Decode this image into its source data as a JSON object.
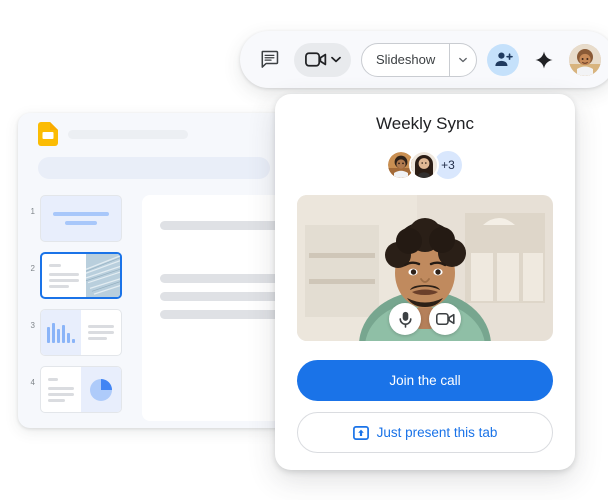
{
  "colors": {
    "brand_blue": "#1a73e8",
    "light_blue": "#c5e1fb",
    "badge_blue": "#d9e7fd",
    "slides_yellow": "#fbbc04",
    "window_bg": "#f6f8fc",
    "placeholder_gray": "#dadce0"
  },
  "toolbar": {
    "chat_icon": "chat-bubble-icon",
    "camera_icon": "video-camera-icon",
    "camera_caret_icon": "chevron-down-icon",
    "slideshow_label": "Slideshow",
    "slideshow_caret_icon": "chevron-down-icon",
    "add_person_icon": "person-add-icon",
    "sparkle_icon": "sparkle-icon",
    "avatar": "user-avatar"
  },
  "slides_window": {
    "app_icon": "google-slides-icon",
    "title_placeholder": "",
    "filmstrip": [
      {
        "number": "1",
        "type": "title-slide",
        "selected": false
      },
      {
        "number": "2",
        "type": "image-slide",
        "selected": true
      },
      {
        "number": "3",
        "type": "bar-chart-slide",
        "selected": false
      },
      {
        "number": "4",
        "type": "pie-chart-slide",
        "selected": false
      }
    ]
  },
  "meeting": {
    "title": "Weekly Sync",
    "participants_overflow": "+3",
    "avatars": [
      "participant-1",
      "participant-2"
    ],
    "video": {
      "mic_icon": "microphone-icon",
      "camera_icon": "video-camera-icon"
    },
    "join_label": "Join the call",
    "present_label": "Just present this tab",
    "present_icon": "present-to-screen-icon"
  }
}
